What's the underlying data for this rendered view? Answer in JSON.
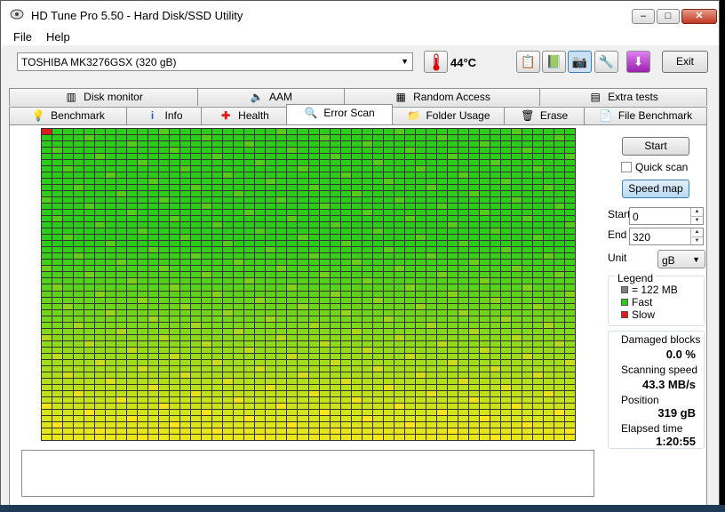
{
  "window": {
    "title": "HD Tune Pro 5.50 - Hard Disk/SSD Utility"
  },
  "window_controls": {
    "minimize": "–",
    "maximize": "□",
    "close": "✕"
  },
  "menu": [
    "File",
    "Help"
  ],
  "toolbar": {
    "drive": "TOSHIBA MK3276GSX (320 gB)",
    "temperature": "44°C",
    "exit_label": "Exit",
    "icons": [
      "copy-info-icon",
      "copy-screenshot-icon",
      "camera-icon",
      "options-icon",
      "download-icon"
    ]
  },
  "tabs_top": [
    {
      "label": "Disk monitor",
      "icon": "disk-monitor-icon"
    },
    {
      "label": "AAM",
      "icon": "speaker-icon"
    },
    {
      "label": "Random Access",
      "icon": "random-access-icon"
    },
    {
      "label": "Extra tests",
      "icon": "extra-tests-icon"
    }
  ],
  "tabs_bottom": [
    {
      "label": "Benchmark",
      "icon": "lightbulb-icon"
    },
    {
      "label": "Info",
      "icon": "info-icon"
    },
    {
      "label": "Health",
      "icon": "health-cross-icon"
    },
    {
      "label": "Error Scan",
      "icon": "magnifier-icon",
      "active": true
    },
    {
      "label": "Folder Usage",
      "icon": "folder-icon"
    },
    {
      "label": "Erase",
      "icon": "trash-icon"
    },
    {
      "label": "File Benchmark",
      "icon": "file-benchmark-icon"
    }
  ],
  "controls": {
    "start_button": "Start",
    "quick_scan_label": "Quick scan",
    "quick_scan_checked": false,
    "speed_map_button": "Speed map",
    "start_label": "Start",
    "start_value": "0",
    "end_label": "End",
    "end_value": "320",
    "unit_label": "Unit",
    "unit_value": "gB"
  },
  "legend": {
    "title": "Legend",
    "items": [
      {
        "label": "= 122 MB",
        "color": "#808080"
      },
      {
        "label": "Fast",
        "color": "#2ecc1a"
      },
      {
        "label": "Slow",
        "color": "#e01b1b"
      }
    ]
  },
  "stats": {
    "damaged_blocks_label": "Damaged blocks",
    "damaged_blocks_value": "0.0 %",
    "scanning_speed_label": "Scanning speed",
    "scanning_speed_value": "43.3 MB/s",
    "position_label": "Position",
    "position_value": "319 gB",
    "elapsed_label": "Elapsed time",
    "elapsed_value": "1:20:55"
  },
  "colors": {
    "fast": "#2ecc1a",
    "slow": "#e01b1b",
    "gradient_mid": "#a8e01a",
    "gradient_end": "#f0f01a",
    "speed_map_button": "#b7d9f2"
  },
  "scan_grid": {
    "columns": 50,
    "rows": 50,
    "first_block_state": "slow"
  }
}
